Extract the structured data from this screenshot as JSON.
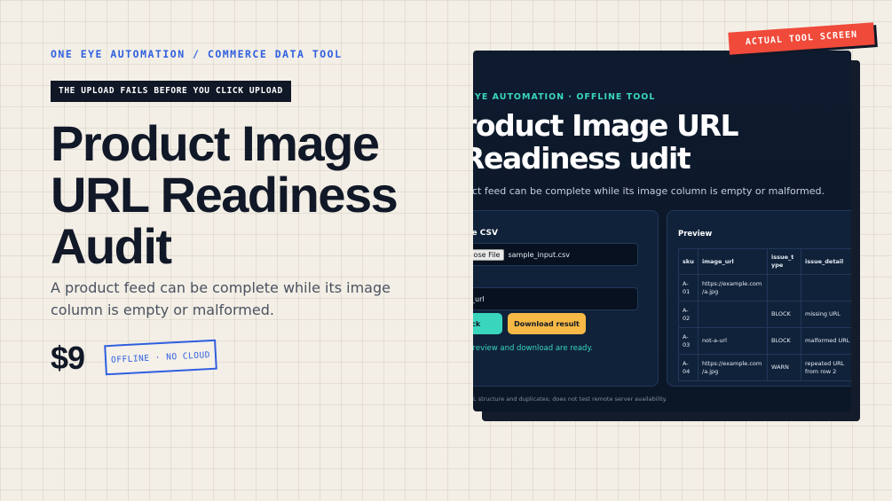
{
  "hero": {
    "brand_line": "ONE EYE AUTOMATION / COMMERCE DATA TOOL",
    "warning_tag": "THE UPLOAD FAILS BEFORE YOU CLICK UPLOAD",
    "title": "Product Image URL Readiness Audit",
    "subtitle": "A product feed can be complete while its image column is empty or malformed.",
    "price": "$9",
    "badge": "OFFLINE · NO CLOUD"
  },
  "ribbon": {
    "label": "ACTUAL TOOL SCREEN"
  },
  "tool": {
    "brand": "YE AUTOMATION · OFFLINE TOOL",
    "title": "roduct Image URL Readiness udit",
    "subtitle": "uct feed can be complete while its image column is empty or malformed.",
    "choose_label": "ose CSV",
    "choose_button": "Choose File",
    "file_name": "sample_input.csv",
    "column_label": "ng",
    "column_value": "ge_url",
    "run_button": "n check",
    "download_button": "Download result",
    "status": ": Preview and download are ready.",
    "footer": "L structure and duplicates; does not test remote server availability.",
    "preview": {
      "title": "Preview",
      "columns": [
        "sku",
        "image_url",
        "issue_type",
        "issue_detail"
      ],
      "rows": [
        [
          "A-01",
          "https://example.com/a.jpg",
          "",
          ""
        ],
        [
          "A-02",
          "",
          "BLOCK",
          "missing URL"
        ],
        [
          "A-03",
          "not-a-url",
          "BLOCK",
          "malformed URL"
        ],
        [
          "A-04",
          "https://example.com/a.jpg",
          "WARN",
          "repeated URL from row 2"
        ]
      ]
    }
  },
  "colors": {
    "accent_blue": "#2f5fe0",
    "ribbon_red": "#f04a3a",
    "teal": "#39d5bd",
    "amber": "#f6b945",
    "dark_navy": "#0e1b2e"
  }
}
